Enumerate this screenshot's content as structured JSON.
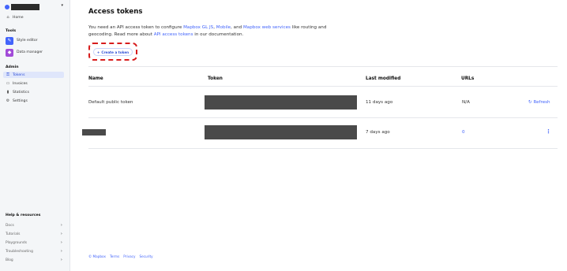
{
  "sidebar": {
    "home_label": "Home",
    "tools_heading": "Tools",
    "tools": [
      {
        "label": "Style editor",
        "color": "#4264fb"
      },
      {
        "label": "Data manager",
        "color": "#a24bd8"
      }
    ],
    "admin_heading": "Admin",
    "admin_items": [
      {
        "label": "Tokens",
        "icon": "key-icon"
      },
      {
        "label": "Invoices",
        "icon": "invoice-icon"
      },
      {
        "label": "Statistics",
        "icon": "bar-chart-icon"
      },
      {
        "label": "Settings",
        "icon": "gear-icon"
      }
    ],
    "help_heading": "Help & resources",
    "help_items": [
      "Docs",
      "Tutorials",
      "Playgrounds",
      "Troubleshooting",
      "Blog"
    ]
  },
  "page": {
    "title": "Access tokens",
    "intro_1": "You need an API access token to configure ",
    "link_gljs": "Mapbox GL JS",
    "sep_1": ", ",
    "link_mobile": "Mobile",
    "sep_2": ", and ",
    "link_services": "Mapbox web services",
    "intro_2": " like routing and geocoding. Read more about ",
    "link_docs": "API access tokens",
    "intro_3": " in our documentation.",
    "create_label": "Create a token"
  },
  "table": {
    "headers": [
      "Name",
      "Token",
      "Last modified",
      "URLs"
    ],
    "rows": [
      {
        "name": "Default public token",
        "modified": "11 days ago",
        "urls": "N/A",
        "action": "Refresh"
      },
      {
        "name": "",
        "modified": "7 days ago",
        "urls": "0",
        "action": ""
      }
    ]
  },
  "footer": {
    "links": [
      "© Mapbox",
      "Terms",
      "Privacy",
      "Security"
    ]
  },
  "colors": {
    "accent": "#4264fb",
    "highlight": "#d71c1c"
  }
}
